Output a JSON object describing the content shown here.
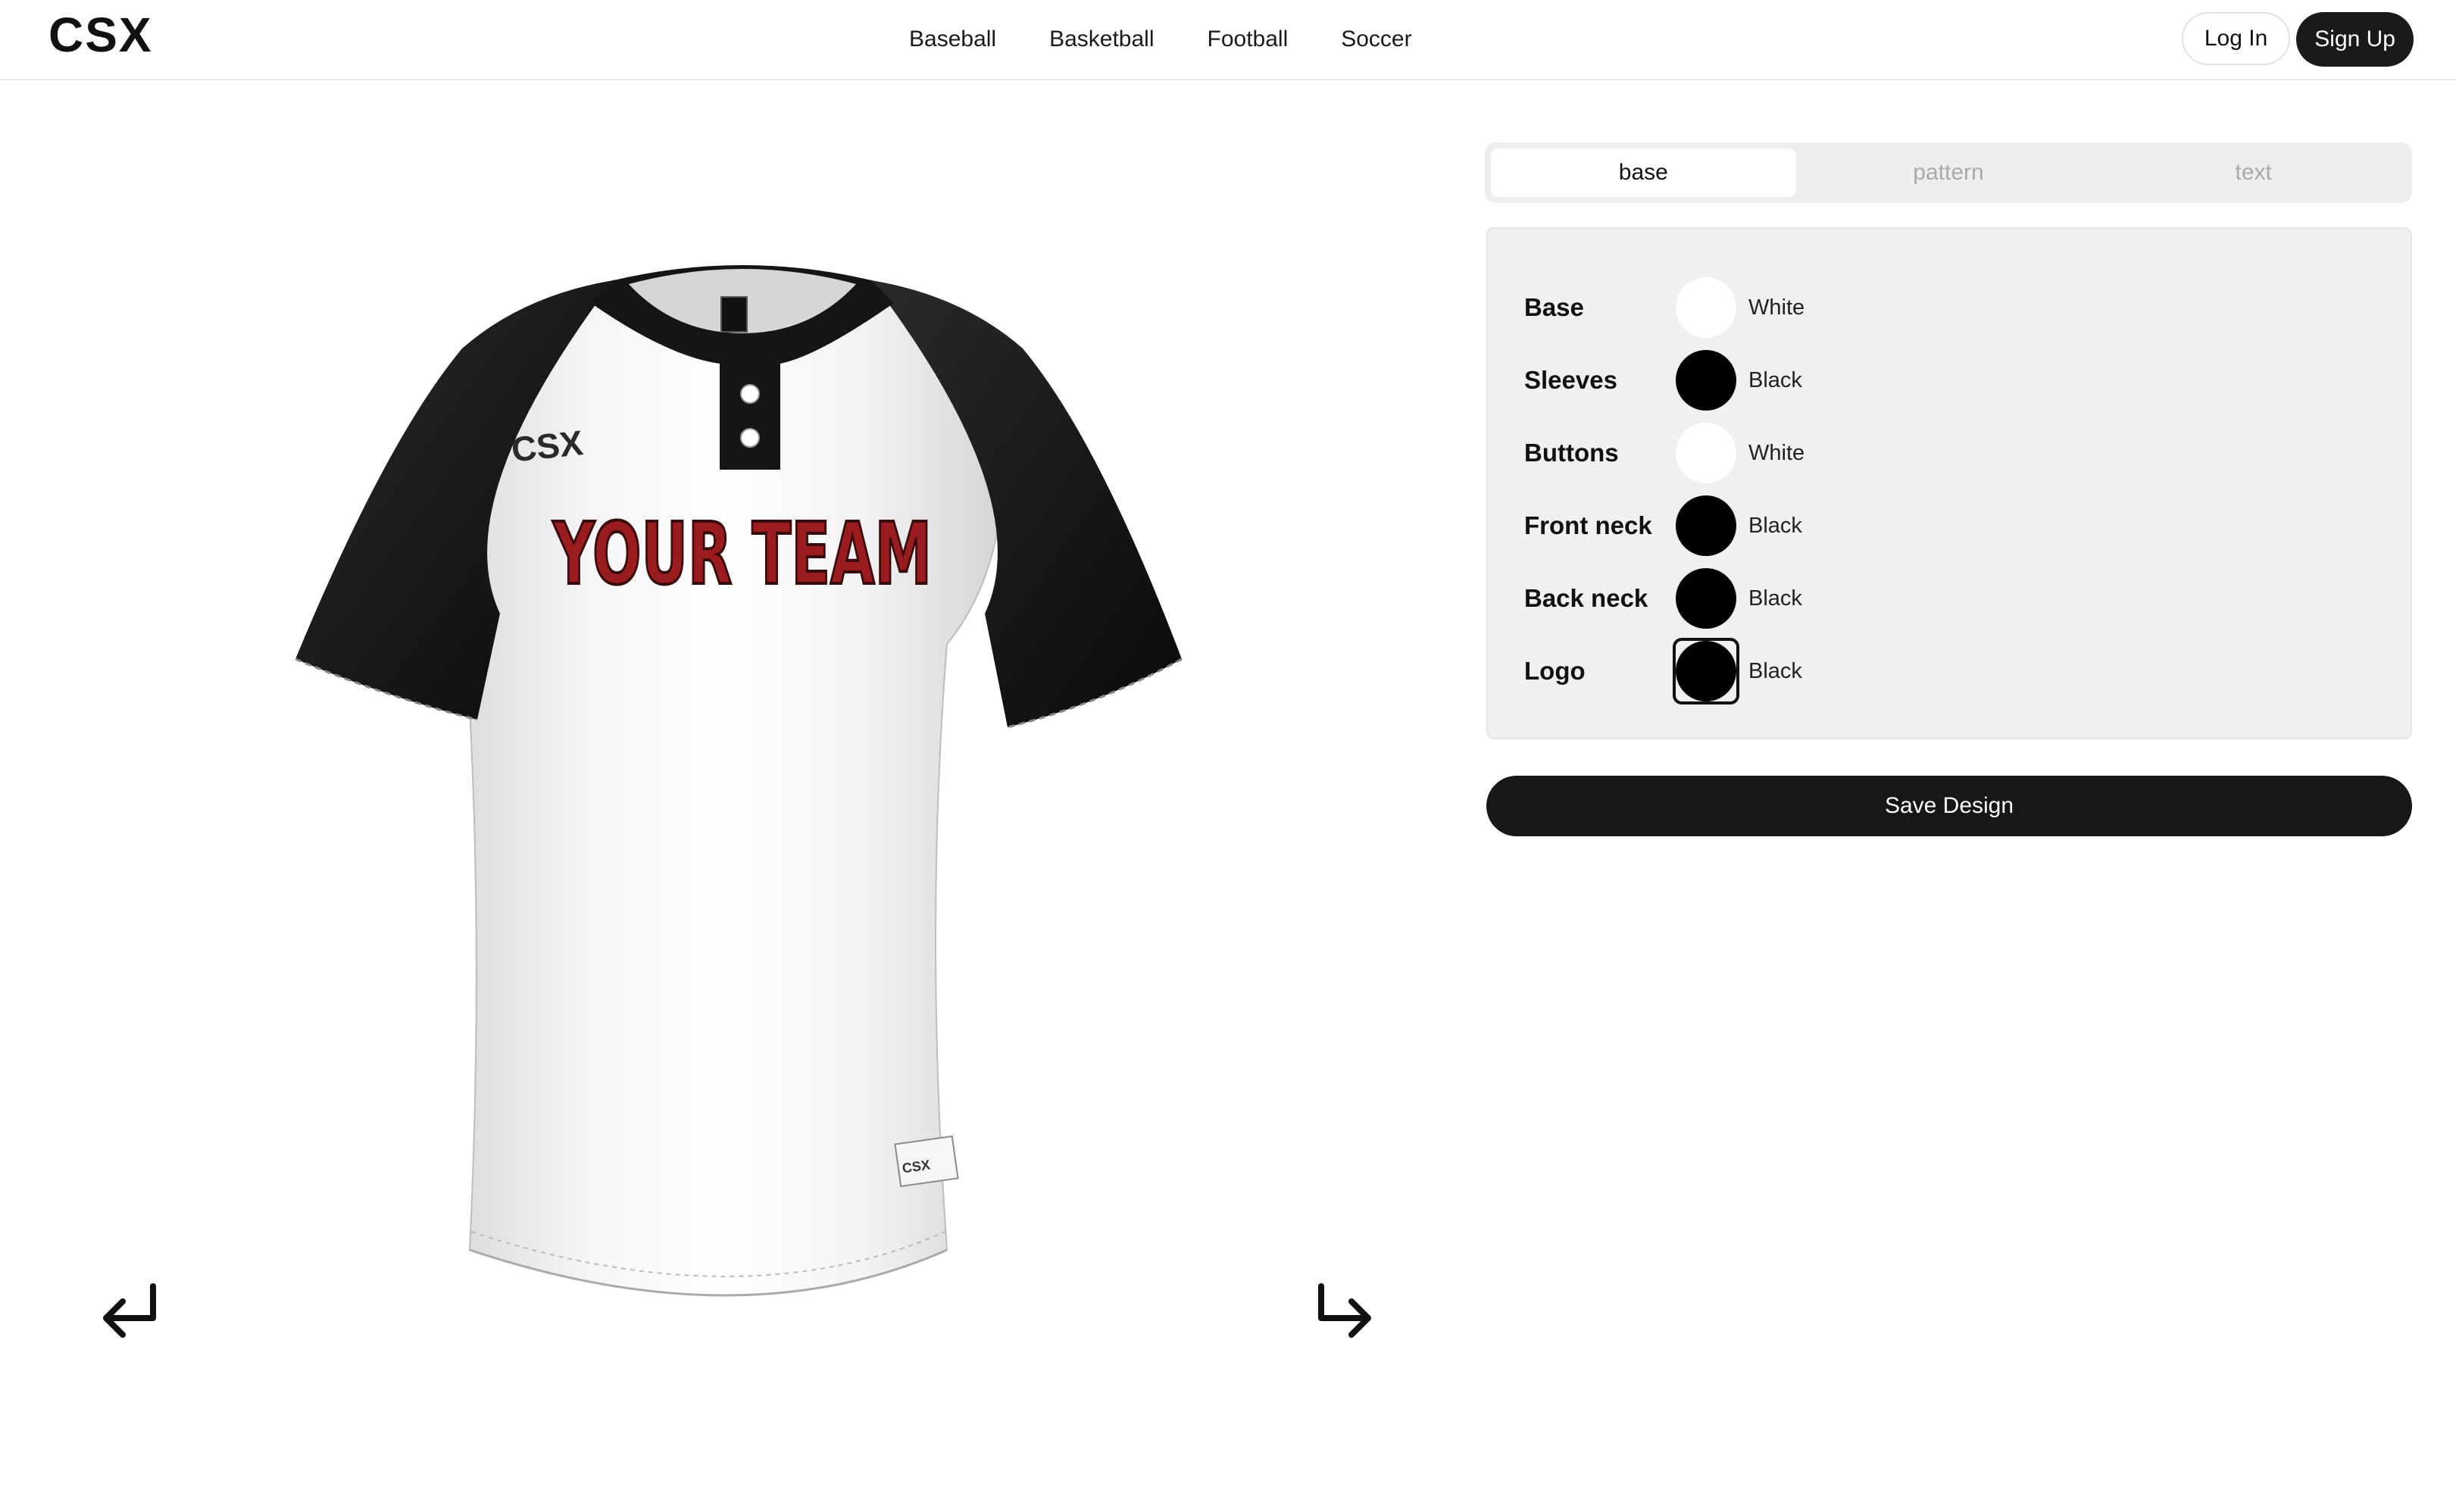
{
  "brand": {
    "name": "CSX"
  },
  "nav": {
    "items": [
      "Baseball",
      "Basketball",
      "Football",
      "Soccer"
    ]
  },
  "auth": {
    "login_label": "Log In",
    "signup_label": "Sign Up"
  },
  "tabs": [
    {
      "label": "base",
      "active": true
    },
    {
      "label": "pattern",
      "active": false
    },
    {
      "label": "text",
      "active": false
    }
  ],
  "options": [
    {
      "label": "Base",
      "value": "White",
      "color": "#ffffff"
    },
    {
      "label": "Sleeves",
      "value": "Black",
      "color": "#000000"
    },
    {
      "label": "Buttons",
      "value": "White",
      "color": "#ffffff"
    },
    {
      "label": "Front neck",
      "value": "Black",
      "color": "#000000"
    },
    {
      "label": "Back neck",
      "value": "Black",
      "color": "#000000"
    },
    {
      "label": "Logo",
      "value": "Black",
      "color": "#000000",
      "selected": true
    }
  ],
  "save_label": "Save Design",
  "jersey": {
    "team_text": "YOUR TEAM",
    "chest_logo": "CSX",
    "tag_logo": "CSX",
    "team_text_color": "#9b1c1f",
    "body_color": "#f2f2f2",
    "sleeve_color": "#141414"
  },
  "icons": {
    "undo": "undo-arrow-icon",
    "redo": "redo-arrow-icon"
  }
}
